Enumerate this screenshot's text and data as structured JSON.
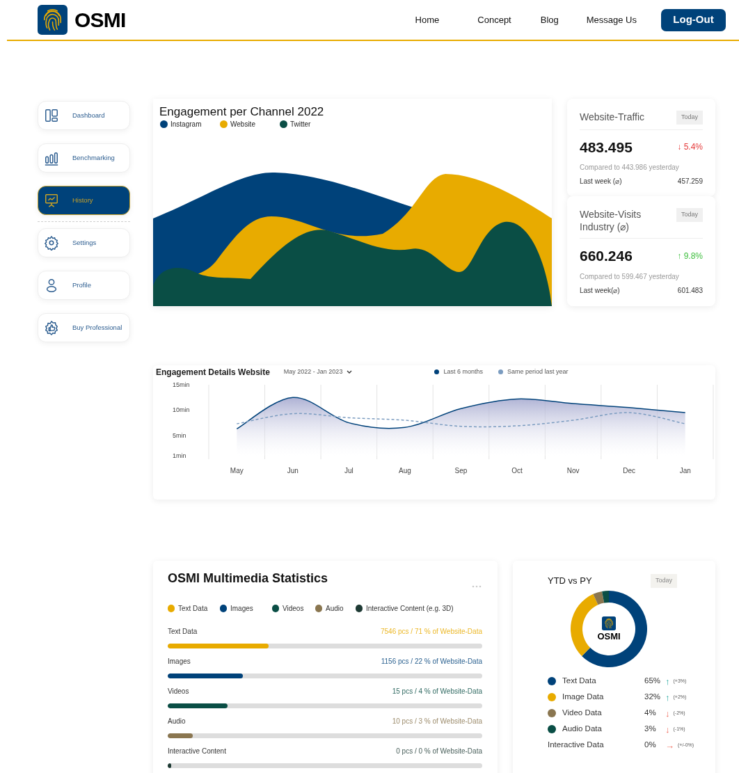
{
  "header": {
    "brand": "OSMI",
    "nav": [
      "Home",
      "Concept",
      "Blog",
      "Message Us"
    ],
    "logout": "Log-Out"
  },
  "sidebar": {
    "groups": [
      {
        "items": [
          {
            "label": "Dashboard",
            "selected": false
          },
          {
            "label": "Benchmarking",
            "selected": false
          },
          {
            "label": "History",
            "selected": true
          }
        ]
      },
      {
        "items": [
          {
            "label": "Settings",
            "selected": false
          },
          {
            "label": "Profile",
            "selected": false
          },
          {
            "label": "Buy Professional",
            "selected": false
          }
        ]
      }
    ]
  },
  "channel_chart": {
    "title": "Engagement per Channel 2022",
    "legend": [
      {
        "label": "Instagram",
        "color": "#00427a"
      },
      {
        "label": "Website",
        "color": "#e8ab00"
      },
      {
        "label": "Twitter",
        "color": "#0a4e45"
      }
    ]
  },
  "stat_cards": [
    {
      "title": "Website-Traffic",
      "badge": "Today",
      "value": "483.495",
      "change": "↓ 5.4%",
      "positive": false,
      "compare": "Compared to 443.986 yesterday",
      "footer_label": "Last week (⌀)",
      "footer_value": "457.259"
    },
    {
      "title": "Website-Visits Industry (⌀)",
      "badge": "Today",
      "value": "660.246",
      "change": "↑ 9.8%",
      "positive": true,
      "compare": "Compared to 599.467 yesterday",
      "footer_label": "Last week(⌀)",
      "footer_value": "601.483"
    }
  ],
  "details": {
    "title": "Engagement Details Website",
    "range": "May 2022 - Jan 2023",
    "chart_data": {
      "type": "line",
      "categories": [
        "May",
        "Jun",
        "Jul",
        "Aug",
        "Sep",
        "Oct",
        "Nov",
        "Dec",
        "Jan"
      ],
      "ylim": [
        1,
        15
      ],
      "yticks": [
        {
          "value": 15,
          "label": "15min"
        },
        {
          "value": 10,
          "label": "10min"
        },
        {
          "value": 5,
          "label": "5min"
        },
        {
          "value": 1,
          "label": "1min"
        }
      ],
      "series": [
        {
          "name": "Last 6 months",
          "color": "#00427a",
          "type": "area",
          "line_style": "solid",
          "values": [
            6.3,
            12.5,
            7.5,
            6.6,
            10.3,
            12.2,
            11.3,
            10.5,
            9.5
          ]
        },
        {
          "name": "Same period last year",
          "color": "#7b9cc0",
          "type": "line",
          "line_style": "dashed",
          "values": [
            7.3,
            9.3,
            8.5,
            8.0,
            6.8,
            6.9,
            8.0,
            9.5,
            7.3
          ]
        }
      ]
    }
  },
  "multimedia": {
    "title": "OSMI Multimedia Statistics",
    "legend": [
      {
        "label": "Text Data",
        "color": "#e8ab00"
      },
      {
        "label": "Images",
        "color": "#00427a"
      },
      {
        "label": "Videos",
        "color": "#0a4e45"
      },
      {
        "label": "Audio",
        "color": "#8a7650"
      },
      {
        "label": "Interactive Content (e.g. 3D)",
        "color": "#1e3a34"
      }
    ],
    "rows": [
      {
        "label": "Text Data",
        "value": "7546 pcs / 71 % of Website-Data",
        "level": 0.32,
        "color": "#e8ab00"
      },
      {
        "label": "Images",
        "value": "1156 pcs / 22 % of Website-Data",
        "level": 0.24,
        "color": "#00427a"
      },
      {
        "label": "Videos",
        "value": "15 pcs / 4 % of Website-Data",
        "level": 0.19,
        "color": "#0a4e45"
      },
      {
        "label": "Audio",
        "value": "10 pcs / 3 % of Website-Data",
        "level": 0.08,
        "color": "#8a7650"
      },
      {
        "label": "Interactive Content",
        "value": "0 pcs / 0 % of Website-Data",
        "level": 0.01,
        "color": "#1e3a34"
      }
    ]
  },
  "ytd": {
    "title": "YTD vs PY",
    "badge": "Today",
    "center_brand": "OSMI",
    "chart_data": {
      "type": "donut",
      "categories": [
        "Text Data",
        "Image Data",
        "Video Data",
        "Audio Data",
        "Interactive Data"
      ],
      "values": [
        62.5,
        30.77,
        3.85,
        2.88,
        0
      ]
    },
    "legend": [
      {
        "percent": "65%",
        "arrow": "↑",
        "change": "(+3%)",
        "positive": true,
        "color": "#00427a"
      },
      {
        "percent": "32%",
        "arrow": "↑",
        "change": "(+2%)",
        "positive": true,
        "color": "#e8ab00"
      },
      {
        "percent": "4%",
        "arrow": "↓",
        "change": "(-2%)",
        "positive": false,
        "color": "#8a7650"
      },
      {
        "percent": "3%",
        "arrow": "↓",
        "change": "(-1%)",
        "positive": false,
        "color": "#0a4e45"
      },
      {
        "percent": "0%",
        "arrow": "→",
        "change": "(+/-0%)",
        "positive": false
      }
    ]
  }
}
